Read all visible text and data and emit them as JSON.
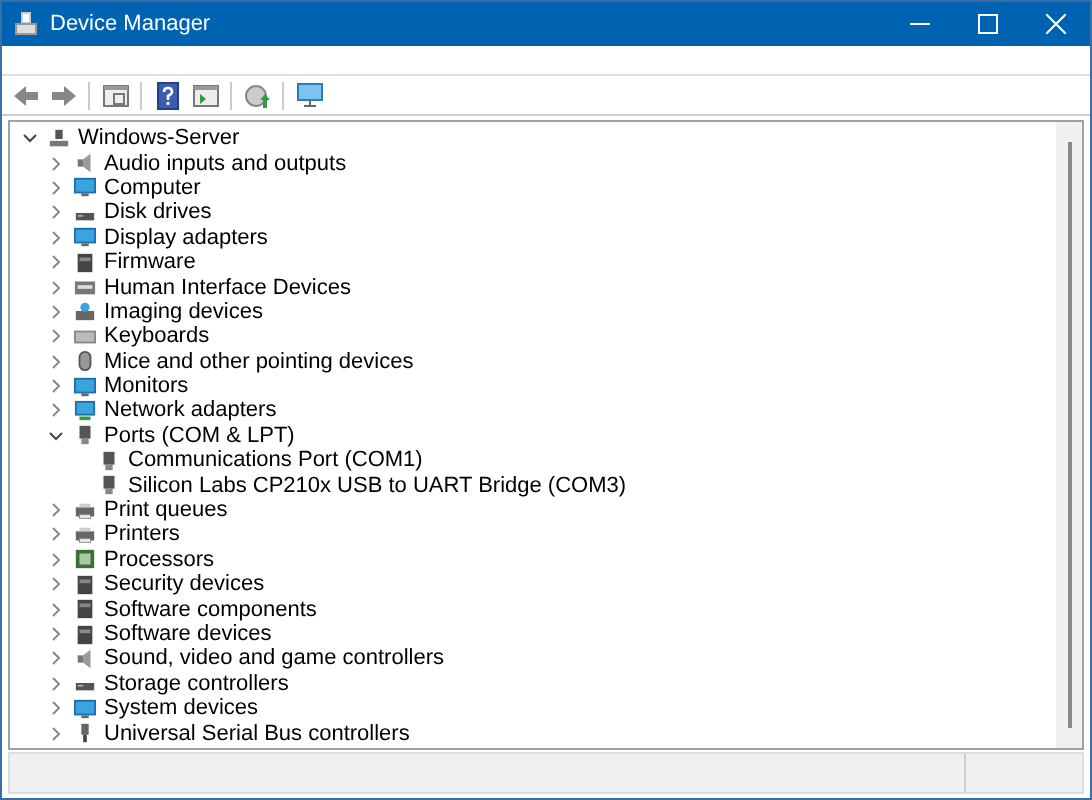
{
  "window": {
    "title": "Device Manager"
  },
  "tree": {
    "label": "Windows-Server",
    "expanded": true,
    "children": [
      {
        "label": "Audio inputs and outputs",
        "expanded": false
      },
      {
        "label": "Computer",
        "expanded": false
      },
      {
        "label": "Disk drives",
        "expanded": false
      },
      {
        "label": "Display adapters",
        "expanded": false
      },
      {
        "label": "Firmware",
        "expanded": false
      },
      {
        "label": "Human Interface Devices",
        "expanded": false
      },
      {
        "label": "Imaging devices",
        "expanded": false
      },
      {
        "label": "Keyboards",
        "expanded": false
      },
      {
        "label": "Mice and other pointing devices",
        "expanded": false
      },
      {
        "label": "Monitors",
        "expanded": false
      },
      {
        "label": "Network adapters",
        "expanded": false
      },
      {
        "label": "Ports (COM & LPT)",
        "expanded": true,
        "children": [
          {
            "label": "Communications Port (COM1)"
          },
          {
            "label": "Silicon Labs CP210x USB to UART Bridge (COM3)"
          }
        ]
      },
      {
        "label": "Print queues",
        "expanded": false
      },
      {
        "label": "Printers",
        "expanded": false
      },
      {
        "label": "Processors",
        "expanded": false
      },
      {
        "label": "Security devices",
        "expanded": false
      },
      {
        "label": "Software components",
        "expanded": false
      },
      {
        "label": "Software devices",
        "expanded": false
      },
      {
        "label": "Sound, video and game controllers",
        "expanded": false
      },
      {
        "label": "Storage controllers",
        "expanded": false
      },
      {
        "label": "System devices",
        "expanded": false
      },
      {
        "label": "Universal Serial Bus controllers",
        "expanded": false
      }
    ]
  }
}
